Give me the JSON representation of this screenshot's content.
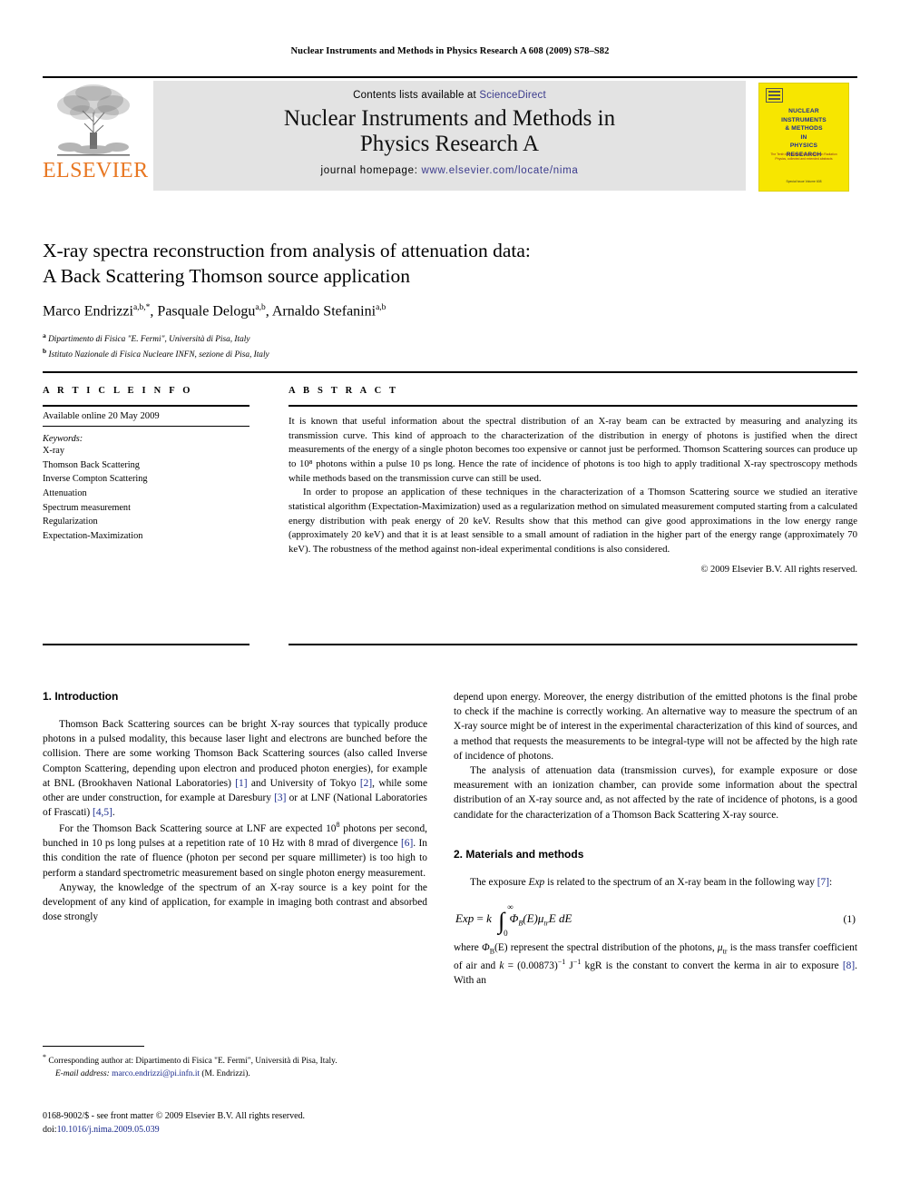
{
  "running_head": "Nuclear Instruments and Methods in Physics Research A 608 (2009) S78–S82",
  "masthead": {
    "publisher_name": "ELSEVIER",
    "contents_prefix": "Contents lists available at ",
    "contents_link": "ScienceDirect",
    "journal_title_line1": "Nuclear Instruments and Methods in",
    "journal_title_line2": "Physics Research A",
    "homepage_label": "journal homepage: ",
    "homepage_url": "www.elsevier.com/locate/nima",
    "cover": {
      "title_lines": [
        "NUCLEAR",
        "INSTRUMENTS",
        "& METHODS",
        "IN",
        "PHYSICS",
        "RESEARCH"
      ],
      "subtitle": "The Tenth International Symposium on Radiation Physics, collected and extended abstracts",
      "footer": "Special Issue Volume 608"
    },
    "colors": {
      "banner_bg": "#e3e3e3",
      "elsevier_orange": "#E87722",
      "link_blue": "#3a3a8c",
      "cover_yellow": "#f7e600",
      "cover_text_blue": "#1a2a9c"
    }
  },
  "article": {
    "title_line1": "X-ray spectra reconstruction from analysis of attenuation data:",
    "title_line2": "A Back Scattering Thomson source application",
    "authors": [
      {
        "name": "Marco Endrizzi",
        "marks": "a,b,*"
      },
      {
        "name": "Pasquale Delogu",
        "marks": "a,b"
      },
      {
        "name": "Arnaldo Stefanini",
        "marks": "a,b"
      }
    ],
    "affiliations": [
      {
        "mark": "a",
        "text": "Dipartimento di Fisica \"E. Fermi\", Università di Pisa, Italy"
      },
      {
        "mark": "b",
        "text": "Istituto Nazionale di Fisica Nucleare INFN, sezione di Pisa, Italy"
      }
    ]
  },
  "info": {
    "heading": "A R T I C L E   I N F O",
    "available_online": "Available online 20 May 2009",
    "keywords_label": "Keywords:",
    "keywords": [
      "X-ray",
      "Thomson Back Scattering",
      "Inverse Compton Scattering",
      "Attenuation",
      "Spectrum measurement",
      "Regularization",
      "Expectation-Maximization"
    ]
  },
  "abstract": {
    "heading": "A B S T R A C T",
    "paragraph1": "It is known that useful information about the spectral distribution of an X-ray beam can be extracted by measuring and analyzing its transmission curve. This kind of approach to the characterization of the distribution in energy of photons is justified when the direct measurements of the energy of a single photon becomes too expensive or cannot just be performed. Thomson Scattering sources can produce up to 10⁸ photons within a pulse 10 ps long. Hence the rate of incidence of photons is too high to apply traditional X-ray spectroscopy methods while methods based on the transmission curve can still be used.",
    "paragraph2": "In order to propose an application of these techniques in the characterization of a Thomson Scattering source we studied an iterative statistical algorithm (Expectation-Maximization) used as a regularization method on simulated measurement computed starting from a calculated energy distribution with peak energy of 20 keV. Results show that this method can give good approximations in the low energy range (approximately 20 keV) and that it is at least sensible to a small amount of radiation in the higher part of the energy range (approximately 70 keV). The robustness of the method against non-ideal experimental conditions is also considered.",
    "copyright": "© 2009 Elsevier B.V. All rights reserved."
  },
  "sections": {
    "introduction_heading": "1.  Introduction",
    "materials_heading": "2.  Materials and methods"
  },
  "body": {
    "left": {
      "p1_a": "Thomson Back Scattering sources can be bright X-ray sources that typically produce photons in a pulsed modality, this because laser light and electrons are bunched before the collision. There are some working Thomson Back Scattering sources (also called Inverse Compton Scattering, depending upon electron and produced photon energies), for example at BNL (Brookhaven National Laboratories) ",
      "p1_ref1": "[1]",
      "p1_b": " and University of Tokyo ",
      "p1_ref2": "[2]",
      "p1_c": ", while some other are under construction, for example at Daresbury ",
      "p1_ref3": "[3]",
      "p1_d": " or at LNF (National Laboratories of Frascati) ",
      "p1_ref4": "[4,5]",
      "p1_e": ".",
      "p2_a": "For the Thomson Back Scattering source at LNF are expected 10",
      "p2_sup": "8",
      "p2_b": " photons per second, bunched in 10 ps long pulses at a repetition rate of 10 Hz with 8 mrad of divergence ",
      "p2_ref": "[6]",
      "p2_c": ". In this condition the rate of fluence (photon per second per square millimeter) is too high to perform a standard spectrometric measurement based on single photon energy measurement.",
      "p3": "Anyway, the knowledge of the spectrum of an X-ray source is a key point for the development of any kind of application, for example in imaging both contrast and absorbed dose strongly"
    },
    "right": {
      "p1": "depend upon energy. Moreover, the energy distribution of the emitted photons is the final probe to check if the machine is correctly working. An alternative way to measure the spectrum of an X-ray source might be of interest in the experimental characterization of this kind of sources, and a method that requests the measurements to be integral-type will not be affected by the high rate of incidence of photons.",
      "p2": "The analysis of attenuation data (transmission curves), for example exposure or dose measurement with an ionization chamber, can provide some information about the spectral distribution of an X-ray source and, as not affected by the rate of incidence of photons, is a good candidate for the characterization of a Thomson Back Scattering X-ray source.",
      "p3_a": "The exposure ",
      "p3_em": "Exp",
      "p3_b": " is related to the spectrum of an X-ray beam in the following way ",
      "p3_ref": "[7]",
      "p3_c": ":",
      "equation": {
        "lhs": "Exp",
        "equals": "=",
        "k": "k",
        "integral_upper": "∞",
        "integral_lower": "0",
        "integrand_phi": "Φ",
        "integrand_phi_sub": "B",
        "integrand_e": "(E)",
        "integrand_mu": "μ",
        "integrand_mu_sub": "tr",
        "integrand_tail": "E dE",
        "number": "(1)"
      },
      "p4_a": "where ",
      "p4_phi": "Φ",
      "p4_phi_sub": "B",
      "p4_b": "(E) represent the spectral distribution of the photons, ",
      "p4_mu": "μ",
      "p4_mu_sub": "tr",
      "p4_c": " is the mass transfer coefficient of air and ",
      "p4_k": "k",
      "p4_d": " = (0.00873)",
      "p4_sup1": "−1",
      "p4_e": " J",
      "p4_sup2": "−1",
      "p4_f": " kgR is the constant to convert the kerma in air to exposure ",
      "p4_ref": "[8]",
      "p4_g": ". With an"
    }
  },
  "footnotes": {
    "corresponding_star": "*",
    "corresponding": " Corresponding author at: Dipartimento di Fisica \"E. Fermi\", Università di Pisa, Italy.",
    "email_label": "E-mail address:",
    "email_address": "marco.endrizzi@pi.infn.it",
    "email_owner": " (M. Endrizzi).",
    "issn_line": "0168-9002/$ - see front matter © 2009 Elsevier B.V. All rights reserved.",
    "doi_label": "doi:",
    "doi_value": "10.1016/j.nima.2009.05.039"
  }
}
